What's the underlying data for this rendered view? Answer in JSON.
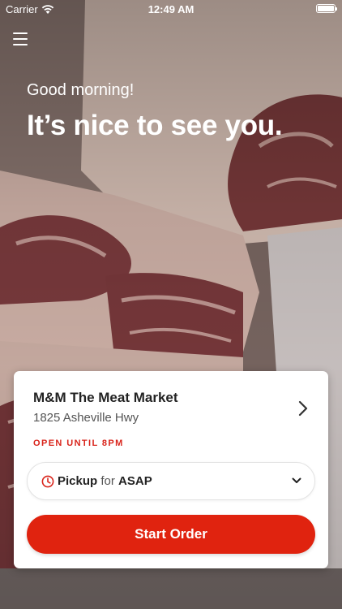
{
  "status_bar": {
    "carrier": "Carrier",
    "time": "12:49 AM"
  },
  "icons": {
    "wifi": "wifi-icon",
    "battery": "battery-icon",
    "menu": "menu-icon",
    "chevron_right": "chevron-right-icon",
    "clock": "clock-icon",
    "chevron_down": "chevron-down-icon"
  },
  "greeting": {
    "salutation": "Good morning!",
    "headline": "It’s nice to see you."
  },
  "store": {
    "name": "M&M The Meat Market",
    "address": "1825 Asheville Hwy",
    "status": "OPEN UNTIL 8PM"
  },
  "order": {
    "mode": "Pickup",
    "connector": "for",
    "time": "ASAP",
    "start_label": "Start Order"
  },
  "colors": {
    "accent": "#e0230f",
    "status_red": "#d9251c"
  }
}
